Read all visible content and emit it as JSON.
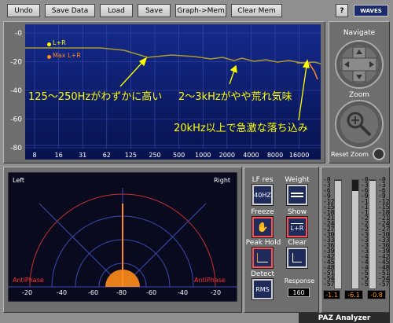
{
  "toolbar": {
    "undo": "Undo",
    "save_data": "Save Data",
    "load": "Load",
    "save": "Save",
    "graph_mem": "Graph->Mem",
    "clear_mem": "Clear Mem",
    "help": "?",
    "brand": "WAVES"
  },
  "analyzer": {
    "legend_lr": "L+R",
    "legend_max": "Max L+R",
    "y_ticks": [
      "-0",
      "-20",
      "-40",
      "-60",
      "-80"
    ],
    "x_ticks": [
      "8",
      "16",
      "31",
      "62",
      "125",
      "250",
      "500",
      "1000",
      "2000",
      "4000",
      "8000",
      "16000"
    ]
  },
  "annotations": {
    "low": "125～250Hzがわずかに高い",
    "mid": "2～3kHzがやや荒れ気味",
    "high": "20kHz以上で急激な落ち込み"
  },
  "navigate": {
    "label": "Navigate",
    "zoom_label": "Zoom",
    "reset_zoom": "Reset Zoom"
  },
  "stereo": {
    "left": "Left",
    "right": "Right",
    "antiphase_left": "AntiPhase",
    "antiphase_right": "AntiPhase",
    "scale": [
      "-20",
      "-40",
      "-60",
      "-80",
      "-60",
      "-40",
      "-20"
    ]
  },
  "controls": {
    "lf_res": "LF res",
    "lf_res_value": "40HZ",
    "weight": "Weight",
    "freeze": "Freeze",
    "show": "Show",
    "show_value": "L+R",
    "peak_hold": "Peak Hold",
    "clear": "Clear",
    "detect": "Detect",
    "detect_value": "RMS",
    "response": "Response",
    "response_value": "160"
  },
  "meters": {
    "scale": [
      "-0",
      "-3",
      "-6",
      "-9",
      "-12",
      "-15",
      "-18",
      "-21",
      "-24",
      "-27",
      "-30",
      "-33",
      "-36",
      "-39",
      "-42",
      "-45",
      "-48",
      "-51",
      "-54",
      "-57"
    ],
    "values": [
      "-1.1",
      "-6.1",
      "-0.8"
    ],
    "levels": [
      0.99,
      0.9,
      0.99
    ]
  },
  "footer": {
    "title": "PAZ Analyzer"
  },
  "colors": {
    "graph_bg": "#0e1f7a",
    "curve": "#a89a2c",
    "max_curve": "#ff8c1a",
    "annotation": "#ffff00"
  }
}
